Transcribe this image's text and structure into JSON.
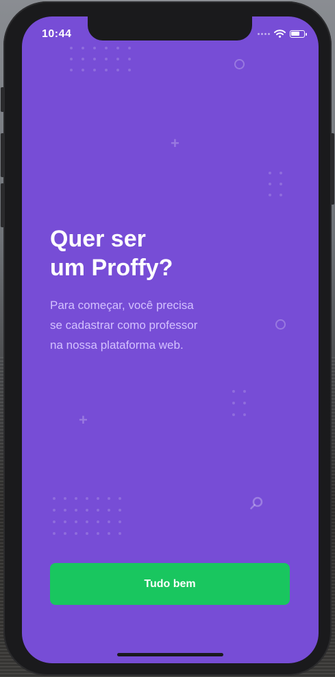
{
  "status_bar": {
    "time": "10:44"
  },
  "onboarding": {
    "title_line1": "Quer ser",
    "title_line2": "um Proffy?",
    "description_line1": "Para começar, você precisa",
    "description_line2": "se cadastrar como professor",
    "description_line3": "na nossa plataforma web."
  },
  "actions": {
    "confirm_label": "Tudo bem"
  },
  "colors": {
    "background": "#774dd6",
    "primary_button": "#19c65f",
    "description_text": "#d4c2ff"
  },
  "icons": {
    "wifi": "wifi-icon",
    "battery": "battery-icon",
    "search": "search-icon",
    "plus": "plus-icon",
    "ring": "ring-icon"
  }
}
